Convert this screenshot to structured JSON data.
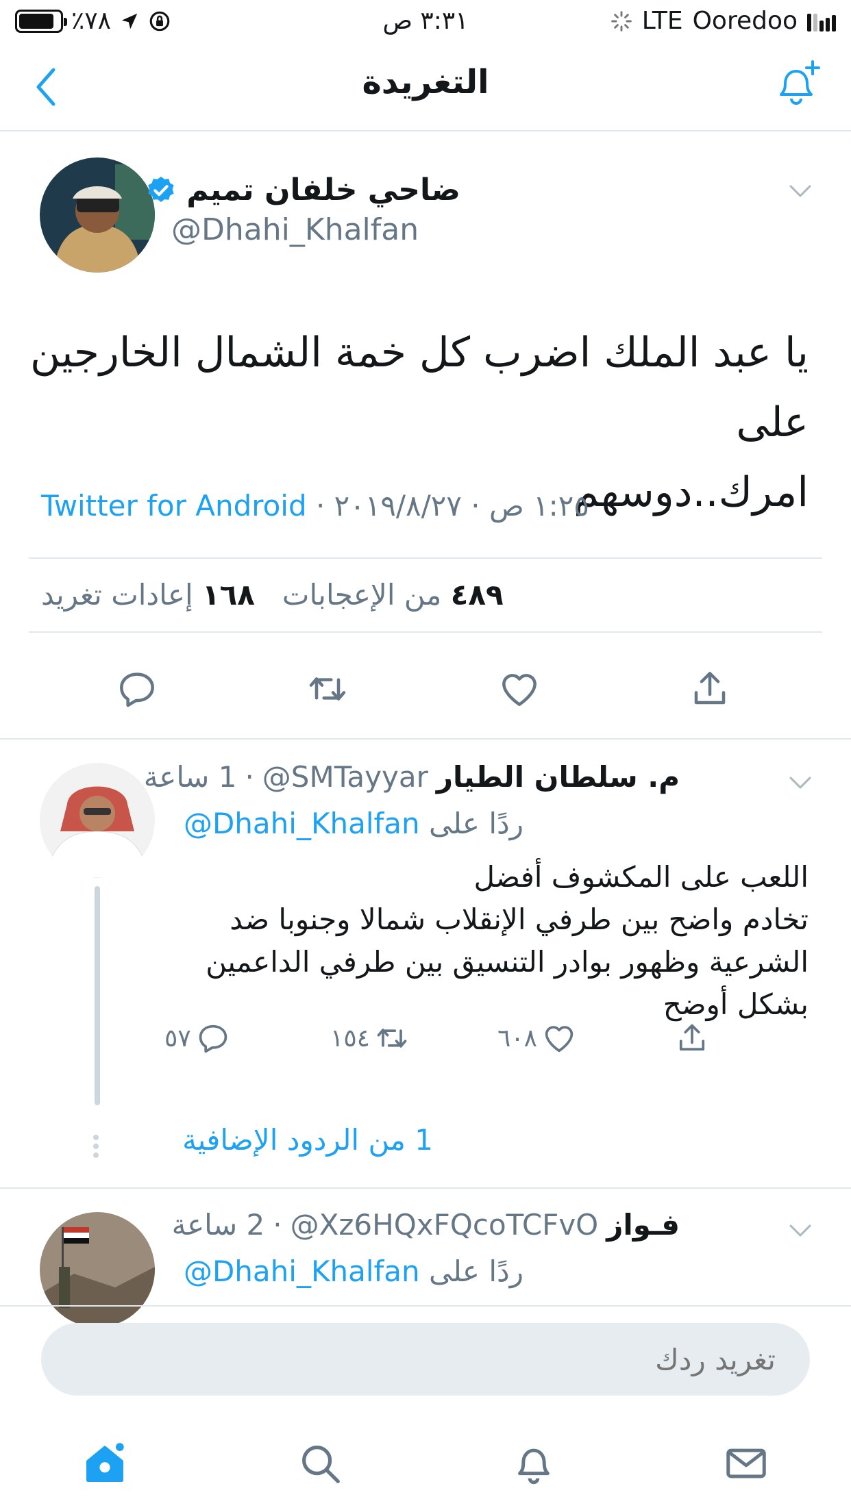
{
  "status_bar": {
    "battery": "٪٧٨",
    "battery_level": 0.78,
    "time": "٣:٣١ ص",
    "network": "LTE",
    "carrier": "Ooredoo"
  },
  "header": {
    "title": "التغريدة"
  },
  "tweet": {
    "author_name": "ضاحي خلفان تميم",
    "author_handle": "@Dhahi_Khalfan",
    "verified": true,
    "text_line1": "يا عبد الملك اضرب كل خمة الشمال الخارجين على",
    "text_line2": "امرك..دوسهم",
    "time": "١:٢٥ ص",
    "date": "٢٠١٩/٨/٢٧",
    "source": "Twitter for Android",
    "likes_count": "٤٨٩",
    "likes_label": "من الإعجابات",
    "retweets_count": "١٦٨",
    "retweets_label": "إعادات تغريد"
  },
  "replies": [
    {
      "name": "م. سلطان الطيار",
      "handle": "@SMTayyar",
      "time": "1 ساعة",
      "replying_label": "ردًا على",
      "replying_to": "@Dhahi_Khalfan",
      "text_lines": [
        "اللعب على المكشوف أفضل",
        "تخادم واضح بين طرفي الإنقلاب شمالا وجنوبا ضد",
        "الشرعية  وظهور بوادر التنسيق بين طرفي الداعمين",
        "بشكل أوضح"
      ],
      "reply_count": "٥٧",
      "retweet_count": "١٥٤",
      "like_count": "٦٠٨",
      "more_replies": "1 من الردود الإضافية"
    },
    {
      "name": "فـواز",
      "handle": "@Xz6HQxFQcoTCFvO",
      "time": "2 ساعة",
      "replying_label": "ردًا على",
      "replying_to": "@Dhahi_Khalfan"
    }
  ],
  "compose": {
    "placeholder": "تغريد ردك"
  },
  "icons": {
    "accent": "#1da1f2",
    "muted": "#657786",
    "divider": "#e1e8ed",
    "tab_home": "home-icon",
    "tab_search": "search-icon",
    "tab_notifications": "bell-icon",
    "tab_messages": "mail-icon"
  }
}
